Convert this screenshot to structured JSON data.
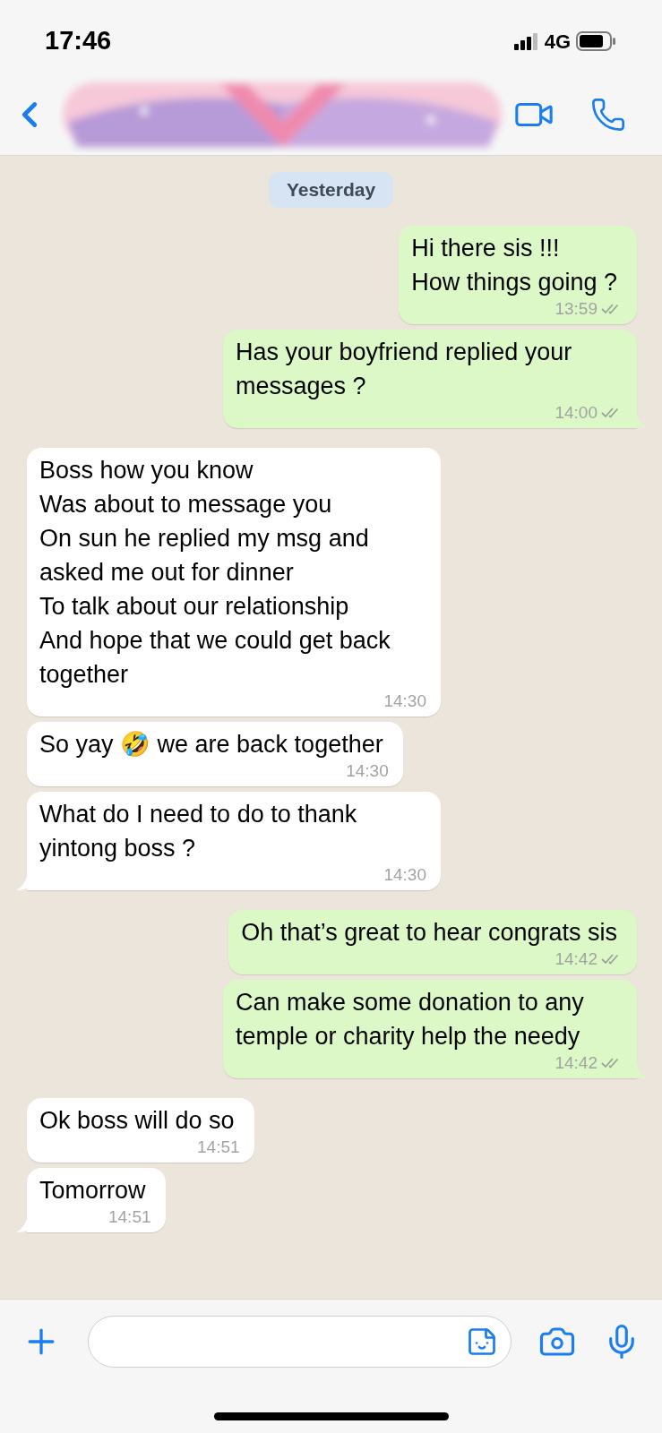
{
  "status_bar": {
    "time": "17:46",
    "network": "4G"
  },
  "date_chip": "Yesterday",
  "messages": [
    {
      "kind": "outgoing",
      "text": "Hi there sis !!!\nHow things going ?",
      "time": "13:59",
      "read": false,
      "tail": false
    },
    {
      "kind": "outgoing",
      "text": "Has your boyfriend replied your messages ?",
      "time": "14:00",
      "read": false,
      "tail": true
    },
    {
      "kind": "incoming",
      "text": "Boss how you know\nWas about to message you\nOn sun he replied my msg and asked me out for dinner\nTo talk about our relationship\nAnd hope that we could get back together",
      "time": "14:30",
      "tail": false
    },
    {
      "kind": "incoming",
      "text": "So yay 🤣 we are back together",
      "time": "14:30",
      "tail": false
    },
    {
      "kind": "incoming",
      "text": "What do I need to do to thank yintong boss ?",
      "time": "14:30",
      "tail": true
    },
    {
      "kind": "outgoing",
      "text": "Oh that’s great to hear congrats sis",
      "time": "14:42",
      "read": false,
      "tail": false
    },
    {
      "kind": "outgoing",
      "text": "Can make some donation to any temple or charity help the needy",
      "time": "14:42",
      "read": false,
      "tail": true
    },
    {
      "kind": "incoming",
      "text": "Ok boss will do so",
      "time": "14:51",
      "tail": false
    },
    {
      "kind": "incoming",
      "text": "Tomorrow",
      "time": "14:51",
      "tail": true
    }
  ]
}
